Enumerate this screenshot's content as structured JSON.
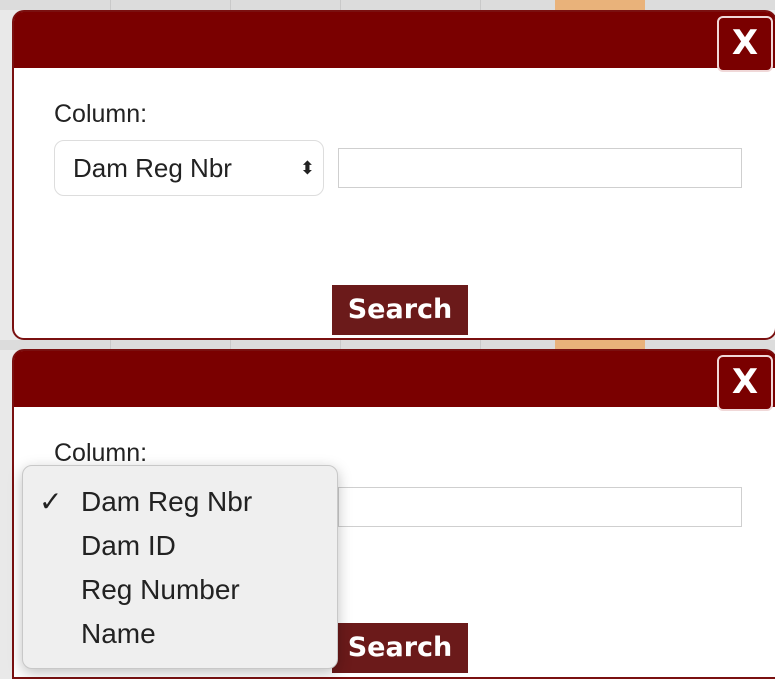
{
  "dialogs": [
    {
      "close_label": "X",
      "column_label": "Column:",
      "select": {
        "selected": "Dam Reg Nbr",
        "arrows": "⬍"
      },
      "search_input": {
        "value": ""
      },
      "search_label": "Search"
    },
    {
      "close_label": "X",
      "column_label": "Column:",
      "search_input": {
        "value": ""
      },
      "search_label": "Search",
      "dropdown": {
        "check_mark": "✓",
        "options": [
          "Dam Reg Nbr",
          "Dam ID",
          "Reg Number",
          "Name"
        ],
        "selected_index": 0
      }
    }
  ],
  "colors": {
    "header": "#7a0000",
    "button": "#6b1a1a"
  }
}
